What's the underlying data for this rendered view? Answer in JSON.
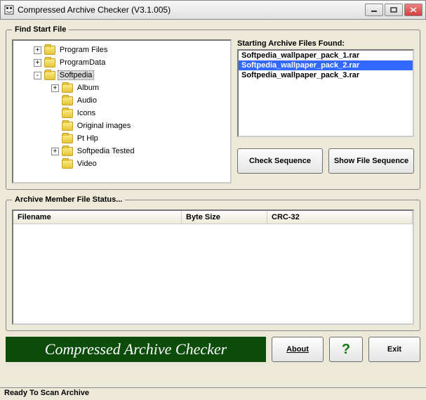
{
  "title": "Compressed Archive Checker (V3.1.005)",
  "findStart": {
    "legend": "Find Start File",
    "tree": [
      {
        "indent": 1,
        "expand": "+",
        "label": "Program Files",
        "selected": false
      },
      {
        "indent": 1,
        "expand": "+",
        "label": "ProgramData",
        "selected": false
      },
      {
        "indent": 1,
        "expand": "-",
        "label": "Softpedia",
        "selected": true
      },
      {
        "indent": 2,
        "expand": "+",
        "label": "Album",
        "selected": false
      },
      {
        "indent": 2,
        "expand": "",
        "label": "Audio",
        "selected": false
      },
      {
        "indent": 2,
        "expand": "",
        "label": "Icons",
        "selected": false
      },
      {
        "indent": 2,
        "expand": "",
        "label": "Original images",
        "selected": false
      },
      {
        "indent": 2,
        "expand": "",
        "label": "Pt Hlp",
        "selected": false
      },
      {
        "indent": 2,
        "expand": "+",
        "label": "Softpedia Tested",
        "selected": false
      },
      {
        "indent": 2,
        "expand": "",
        "label": "Video",
        "selected": false
      }
    ],
    "foundLabel": "Starting Archive Files Found:",
    "foundItems": [
      {
        "name": "Softpedia_wallpaper_pack_1.rar",
        "selected": false
      },
      {
        "name": "Softpedia_wallpaper_pack_2.rar",
        "selected": true
      },
      {
        "name": "Softpedia_wallpaper_pack_3.rar",
        "selected": false
      }
    ],
    "checkSeq": "Check Sequence",
    "showSeq": "Show File Sequence"
  },
  "memberStatus": {
    "legend": "Archive Member File Status...",
    "cols": {
      "filename": "Filename",
      "byteSize": "Byte Size",
      "crc": "CRC-32"
    }
  },
  "bottom": {
    "banner": "Compressed Archive Checker",
    "about": "About",
    "question": "?",
    "exit": "Exit"
  },
  "status": "Ready To Scan Archive"
}
